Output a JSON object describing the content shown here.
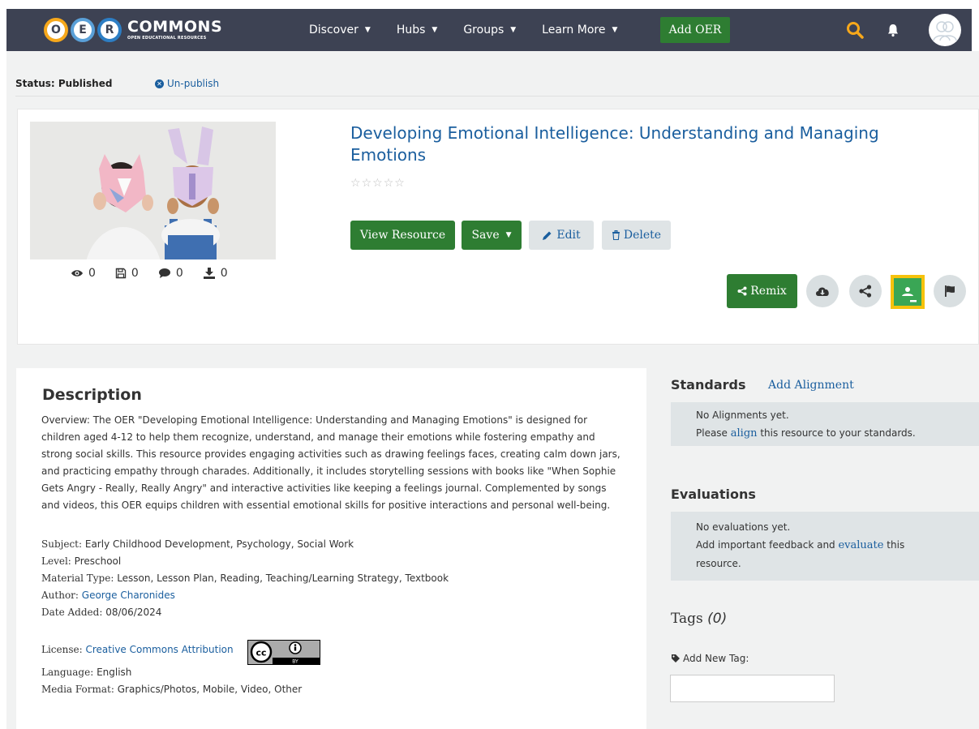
{
  "brand": {
    "letters": [
      "O",
      "E",
      "R"
    ],
    "name": "COMMONS",
    "tagline": "OPEN EDUCATIONAL RESOURCES"
  },
  "nav": {
    "items": [
      {
        "label": "Discover"
      },
      {
        "label": "Hubs"
      },
      {
        "label": "Groups"
      },
      {
        "label": "Learn More"
      }
    ],
    "add_oer": "Add OER"
  },
  "status": {
    "label": "Status: Published",
    "unpublish": "Un-publish"
  },
  "resource": {
    "title": "Developing Emotional Intelligence: Understanding and Managing Emotions",
    "rating": 0,
    "stats": {
      "views": "0",
      "saves": "0",
      "comments": "0",
      "downloads": "0"
    },
    "buttons": {
      "view": "View Resource",
      "save": "Save",
      "edit": "Edit",
      "delete": "Delete",
      "remix": "Remix"
    },
    "action_icons": [
      "cloud-download-icon",
      "share-icon",
      "google-classroom-icon",
      "flag-icon"
    ]
  },
  "description": {
    "heading": "Description",
    "overview": "Overview: The OER \"Developing Emotional Intelligence: Understanding and Managing Emotions\" is designed for children aged 4-12 to help them recognize, understand, and manage their emotions while fostering empathy and strong social skills. This resource provides engaging activities such as drawing feelings faces, creating calm down jars, and practicing empathy through charades. Additionally, it includes storytelling sessions with books like \"When Sophie Gets Angry - Really, Really Angry\" and interactive activities like keeping a feelings journal. Complemented by songs and videos, this OER equips children with essential emotional skills for positive interactions and personal well-being.",
    "subject_label": "Subject:",
    "subject": "Early Childhood Development, Psychology, Social Work",
    "level_label": "Level:",
    "level": "Preschool",
    "material_label": "Material Type:",
    "material": "Lesson, Lesson Plan, Reading, Teaching/Learning Strategy, Textbook",
    "author_label": "Author:",
    "author": "George Charonides",
    "date_label": "Date Added:",
    "date": "08/06/2024",
    "license_label": "License:",
    "license": "Creative Commons Attribution",
    "license_badge": {
      "cc": "cc",
      "by": "BY"
    },
    "language_label": "Language:",
    "language": "English",
    "media_label": "Media Format:",
    "media": "Graphics/Photos, Mobile, Video, Other"
  },
  "standards": {
    "heading": "Standards",
    "add": "Add Alignment",
    "empty_line1": "No Alignments yet.",
    "empty_pre": "Please ",
    "empty_link": "align",
    "empty_post": " this resource to your standards."
  },
  "evaluations": {
    "heading": "Evaluations",
    "empty_line1": "No evaluations yet.",
    "empty_pre": "Add important feedback and ",
    "empty_link": "evaluate",
    "empty_post": " this resource."
  },
  "tags": {
    "heading": "Tags",
    "count": "(0)",
    "add_label": "Add New Tag:",
    "input_value": ""
  },
  "colors": {
    "nav_bg": "#3d4253",
    "green": "#2e7d32",
    "link": "#1a5e9e",
    "gray_button": "#dfe4e6",
    "page_bg": "#f1f2f2"
  }
}
